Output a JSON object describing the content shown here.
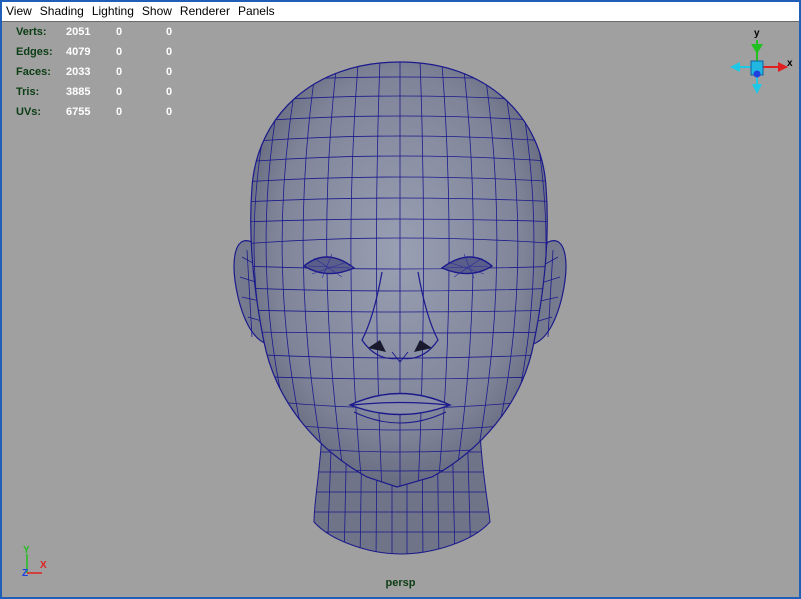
{
  "menu": {
    "items": [
      "View",
      "Shading",
      "Lighting",
      "Show",
      "Renderer",
      "Panels"
    ]
  },
  "hud": {
    "rows": [
      {
        "label": "Verts:",
        "v1": "2051",
        "v2": "0",
        "v3": "0"
      },
      {
        "label": "Edges:",
        "v1": "4079",
        "v2": "0",
        "v3": "0"
      },
      {
        "label": "Faces:",
        "v1": "2033",
        "v2": "0",
        "v3": "0"
      },
      {
        "label": "Tris:",
        "v1": "3885",
        "v2": "0",
        "v3": "0"
      },
      {
        "label": "UVs:",
        "v1": "6755",
        "v2": "0",
        "v3": "0"
      }
    ]
  },
  "view_cube": {
    "axis_y": "y",
    "axis_x": "x"
  },
  "axis_gizmo": {
    "axis_y": "Y",
    "axis_x": "X",
    "axis_z": "Z"
  },
  "camera": {
    "name": "persp"
  },
  "colors": {
    "viewport_bg": "#a0a0a0",
    "wire": "#1b1a8c",
    "hud_label": "#0b3d14",
    "axis_x": "#e02020",
    "axis_y": "#20c020",
    "axis_z": "#2040e0"
  }
}
